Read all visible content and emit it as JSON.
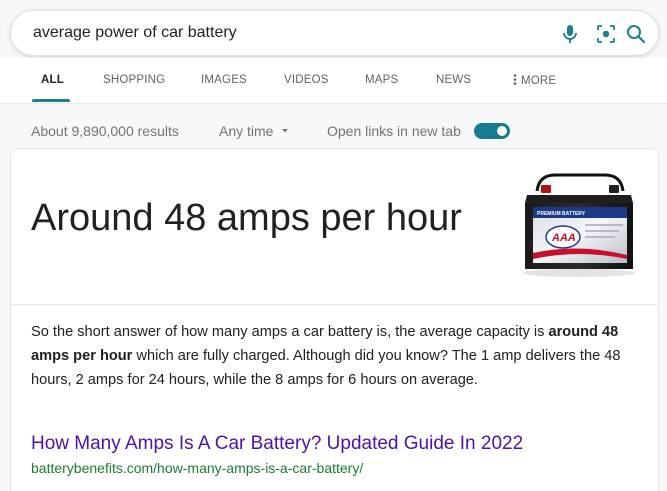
{
  "search": {
    "query": "average power of car battery"
  },
  "tabs": [
    {
      "label": "ALL",
      "active": true
    },
    {
      "label": "SHOPPING"
    },
    {
      "label": "IMAGES"
    },
    {
      "label": "VIDEOS"
    },
    {
      "label": "MAPS"
    },
    {
      "label": "NEWS"
    },
    {
      "label": "MORE"
    }
  ],
  "tools": {
    "results_count": "About 9,890,000 results",
    "time_filter": "Any time",
    "new_tab_label": "Open links in new tab",
    "new_tab_enabled": true
  },
  "answer": {
    "headline": "Around 48 amps per hour",
    "image_name": "car-battery-image",
    "image_text": {
      "brand": "AAA",
      "label": "PREMIUM BATTERY"
    },
    "snippet_before": "So the short answer of how many amps a car battery is, the average capacity is ",
    "snippet_bold": "around 48 amps per hour",
    "snippet_after": " which are fully charged. Although did you know? The 1 amp delivers the 48 hours, 2 amps for 24 hours, while the 8 amps for 6 hours on average.",
    "result_title": "How Many Amps Is A Car Battery? Updated Guide In 2022",
    "result_url": "batterybenefits.com/how-many-amps-is-a-car-battery/"
  },
  "colors": {
    "accent": "#1a7f8f",
    "link_visited": "#4e12a6",
    "url_green": "#1e7a34",
    "toggle_on": "#167b8e"
  },
  "icons": [
    "microphone-icon",
    "lens-icon",
    "search-icon",
    "more-dots-icon",
    "dropdown-caret-icon"
  ]
}
